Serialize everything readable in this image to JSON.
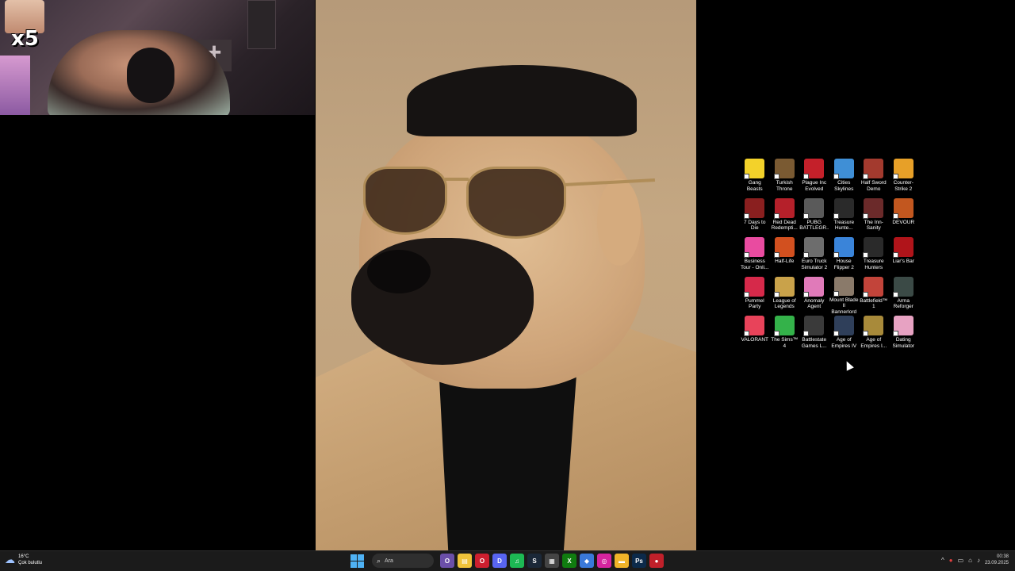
{
  "webcam": {
    "multiplier": "x5"
  },
  "desktop": {
    "icons": [
      {
        "label": "Gang Beasts",
        "color": "#f3d22a",
        "icon": "gang-beasts-icon"
      },
      {
        "label": "Turkish Throne",
        "color": "#7a5a32",
        "icon": "turkish-throne-icon"
      },
      {
        "label": "Plague Inc Evolved",
        "color": "#c4202a",
        "icon": "plague-inc-icon"
      },
      {
        "label": "Cities Skylines",
        "color": "#3f8fd6",
        "icon": "cities-skylines-icon"
      },
      {
        "label": "Half Sword Demo",
        "color": "#a33a2e",
        "icon": "half-sword-icon"
      },
      {
        "label": "Counter-Strike 2",
        "color": "#e7a028",
        "icon": "counter-strike-icon"
      },
      {
        "label": "7 Days to Die",
        "color": "#8a1f1f",
        "icon": "7-days-to-die-icon"
      },
      {
        "label": "Red Dead Redempti...",
        "color": "#b5202a",
        "icon": "red-dead-icon"
      },
      {
        "label": "PUBG BATTLEGR...",
        "color": "#5a5a5a",
        "icon": "pubg-icon"
      },
      {
        "label": "Treasure Hunte...",
        "color": "#2a2a2a",
        "icon": "treasure-hunter-icon"
      },
      {
        "label": "The Inn-Sanity",
        "color": "#6b2a2a",
        "icon": "inn-sanity-icon"
      },
      {
        "label": "DEVOUR",
        "color": "#c2571f",
        "icon": "devour-icon"
      },
      {
        "label": "Business Tour - Onli...",
        "color": "#e94ba0",
        "icon": "business-tour-icon"
      },
      {
        "label": "Half-Life",
        "color": "#d2501f",
        "icon": "half-life-icon"
      },
      {
        "label": "Euro Truck Simulator 2",
        "color": "#6d6d6d",
        "icon": "euro-truck-icon"
      },
      {
        "label": "House Flipper 2",
        "color": "#3a84d9",
        "icon": "house-flipper-icon"
      },
      {
        "label": "Treasure Hunters",
        "color": "#2a2a2a",
        "icon": "treasure-hunters-icon"
      },
      {
        "label": "Liar's Bar",
        "color": "#b0141a",
        "icon": "liars-bar-icon"
      },
      {
        "label": "Pummel Party",
        "color": "#d6294a",
        "icon": "pummel-party-icon"
      },
      {
        "label": "League of Legends",
        "color": "#c9a24a",
        "icon": "league-of-legends-icon"
      },
      {
        "label": "Anomaly Agent",
        "color": "#e07ab9",
        "icon": "anomaly-agent-icon"
      },
      {
        "label": "Mount Blade II Bannerlord",
        "color": "#8a7a6a",
        "icon": "bannerlord-icon"
      },
      {
        "label": "Battlefield™ 1",
        "color": "#c2443a",
        "icon": "battlefield-icon"
      },
      {
        "label": "Arma Reforger",
        "color": "#3b4a46",
        "icon": "arma-reforger-icon"
      },
      {
        "label": "VALORANT",
        "color": "#e8435a",
        "icon": "valorant-icon"
      },
      {
        "label": "The Sims™ 4",
        "color": "#34b24a",
        "icon": "sims-icon"
      },
      {
        "label": "Battlestate Games L...",
        "color": "#3a3a3a",
        "icon": "battlestate-icon"
      },
      {
        "label": "Age of Empires IV",
        "color": "#2f3f5a",
        "icon": "aoe4-icon"
      },
      {
        "label": "Age of Empires I...",
        "color": "#a88a3a",
        "icon": "aoe-icon"
      },
      {
        "label": "Dating Simulator",
        "color": "#e7a2c2",
        "icon": "dating-sim-icon"
      }
    ]
  },
  "taskbar": {
    "weather_temp": "16°C",
    "weather_desc": "Çok bulutlu",
    "search_placeholder": "Ara",
    "apps": [
      {
        "name": "browser",
        "color": "#6b4fa8",
        "glyph": "O"
      },
      {
        "name": "explorer",
        "color": "#f0c33a",
        "glyph": "▤"
      },
      {
        "name": "opera",
        "color": "#cc1f2f",
        "glyph": "O"
      },
      {
        "name": "discord",
        "color": "#5865f2",
        "glyph": "D"
      },
      {
        "name": "spotify",
        "color": "#1db954",
        "glyph": "♫"
      },
      {
        "name": "steam",
        "color": "#1b2838",
        "glyph": "S"
      },
      {
        "name": "devhome",
        "color": "#444",
        "glyph": "▦"
      },
      {
        "name": "xbox",
        "color": "#107c10",
        "glyph": "X"
      },
      {
        "name": "copilot",
        "color": "#3a79d9",
        "glyph": "◆"
      },
      {
        "name": "instagram",
        "color": "#d6249f",
        "glyph": "◎"
      },
      {
        "name": "files",
        "color": "#f0b429",
        "glyph": "▬"
      },
      {
        "name": "photoshop",
        "color": "#0c2a4a",
        "glyph": "Ps"
      },
      {
        "name": "recorder",
        "color": "#c0202a",
        "glyph": "●"
      }
    ],
    "time": "00:38",
    "date": "23.09.2025"
  }
}
